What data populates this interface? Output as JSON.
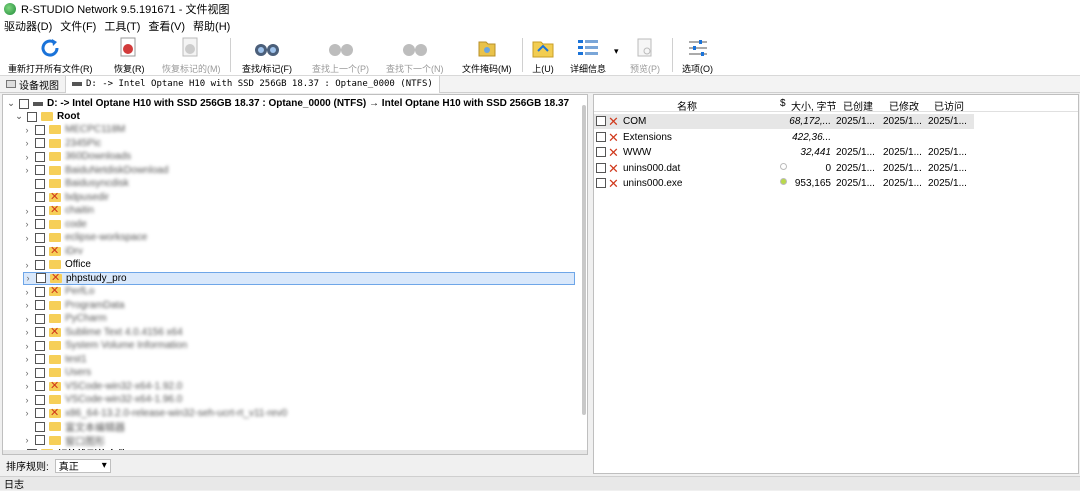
{
  "window": {
    "title": "R-STUDIO Network 9.5.191671 - 文件视图"
  },
  "menu": [
    "驱动器(D)",
    "文件(F)",
    "工具(T)",
    "查看(V)",
    "帮助(H)"
  ],
  "toolbar": {
    "rescan": "重新打开所有文件(R)",
    "recover": "恢复(R)",
    "recover_marked": "恢复标记的(M)",
    "find_mark": "查找/标记(F)",
    "find_prev": "查找上一个(P)",
    "find_next": "查找下一个(N)",
    "file_mask": "文件掩码(M)",
    "up": "上(U)",
    "details": "详细信息",
    "preview": "预览(P)",
    "options": "选项(O)"
  },
  "tabs": {
    "device_view": "设备视图",
    "file_view": "D: -> Intel Optane H10 with SSD 256GB 18.37 : Optane_0000 (NTFS)"
  },
  "tree": {
    "root_drive": "D: -> Intel Optane H10 with SSD 256GB 18.37 : Optane_0000 (NTFS) → Intel Optane H10 with SSD 256GB 18.37",
    "root_folder": "Root",
    "items": [
      {
        "name": "MECPC118M",
        "deleted": false,
        "blur": true,
        "chev": true
      },
      {
        "name": "2345Pic",
        "deleted": false,
        "blur": true,
        "chev": true
      },
      {
        "name": "360Downloads",
        "deleted": false,
        "blur": true,
        "chev": true
      },
      {
        "name": "BaiduNetdiskDownload",
        "deleted": false,
        "blur": true,
        "chev": true
      },
      {
        "name": "Baidusyncdisk",
        "deleted": false,
        "blur": true,
        "chev": false
      },
      {
        "name": "bdpusedir",
        "deleted": true,
        "blur": true,
        "chev": false
      },
      {
        "name": "chaitin",
        "deleted": true,
        "blur": true,
        "chev": true
      },
      {
        "name": "code",
        "deleted": false,
        "blur": true,
        "chev": true
      },
      {
        "name": "eclipse-workspace",
        "deleted": false,
        "blur": true,
        "chev": true
      },
      {
        "name": "iDrv",
        "deleted": true,
        "blur": true,
        "chev": false
      },
      {
        "name": "Office",
        "deleted": false,
        "blur": false,
        "chev": true
      },
      {
        "name": "phpstudy_pro",
        "deleted": true,
        "blur": false,
        "chev": true,
        "selected": true
      },
      {
        "name": "PerfLo",
        "deleted": true,
        "blur": true,
        "chev": true
      },
      {
        "name": "ProgramData",
        "deleted": false,
        "blur": true,
        "chev": true
      },
      {
        "name": "PyCharm",
        "deleted": false,
        "blur": true,
        "chev": true
      },
      {
        "name": "Sublime Text 4.0.4156 x64",
        "deleted": true,
        "blur": true,
        "chev": true
      },
      {
        "name": "System Volume Information",
        "deleted": false,
        "blur": true,
        "chev": true
      },
      {
        "name": "test1",
        "deleted": false,
        "blur": true,
        "chev": true
      },
      {
        "name": "Users",
        "deleted": false,
        "blur": true,
        "chev": true
      },
      {
        "name": "VSCode-win32-x64-1.92.0",
        "deleted": true,
        "blur": true,
        "chev": true
      },
      {
        "name": "VSCode-win32-x64-1.96.0",
        "deleted": false,
        "blur": true,
        "chev": true
      },
      {
        "name": "x86_64-13.2.0-release-win32-seh-ucrt-rt_v11-rev0",
        "deleted": true,
        "blur": true,
        "chev": true
      },
      {
        "name": "富文本编辑器",
        "deleted": false,
        "blur": true,
        "chev": false
      },
      {
        "name": "窗口图形",
        "deleted": false,
        "blur": true,
        "chev": true
      }
    ],
    "extra_found": "额外找到的文件"
  },
  "sort": {
    "label": "排序规则:",
    "value": "真正"
  },
  "list": {
    "headers": {
      "name": "名称",
      "flag": "$",
      "size": "大小, 字节",
      "created": "已创建",
      "modified": "已修改",
      "accessed": "已访问"
    },
    "rows": [
      {
        "name": "COM",
        "size": "68,172,...",
        "created": "2025/1...",
        "modified": "2025/1...",
        "accessed": "2025/1...",
        "italic": true,
        "dot": ""
      },
      {
        "name": "Extensions",
        "size": "422,36...",
        "created": "",
        "modified": "",
        "accessed": "",
        "italic": true,
        "dot": ""
      },
      {
        "name": "WWW",
        "size": "32,441",
        "created": "2025/1...",
        "modified": "2025/1...",
        "accessed": "2025/1...",
        "italic": true,
        "dot": ""
      },
      {
        "name": "unins000.dat",
        "size": "0",
        "created": "2025/1...",
        "modified": "2025/1...",
        "accessed": "2025/1...",
        "italic": false,
        "dot": "#ffffff"
      },
      {
        "name": "unins000.exe",
        "size": "953,165",
        "created": "2025/1...",
        "modified": "2025/1...",
        "accessed": "2025/1...",
        "italic": false,
        "dot": "#b9d94a"
      }
    ]
  },
  "status": {
    "log": "日志"
  }
}
